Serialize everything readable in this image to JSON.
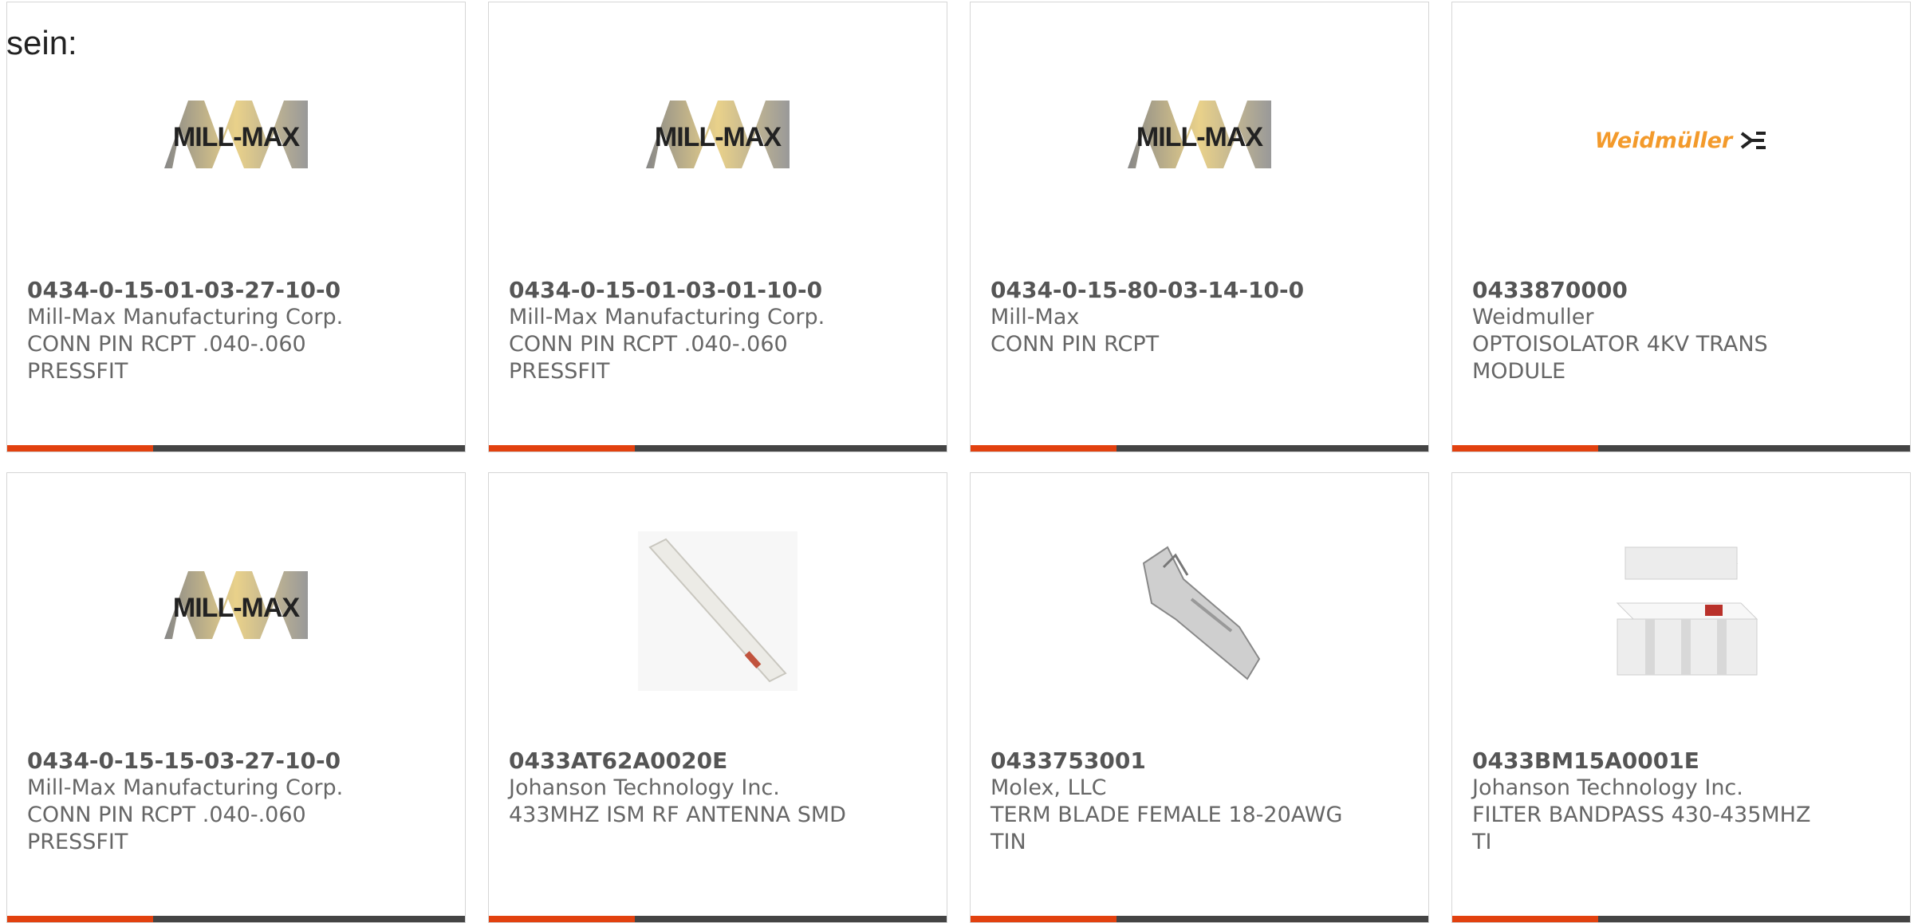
{
  "intro": "sein:",
  "cards": [
    {
      "pn": "0434-0-15-01-03-27-10-0",
      "mfr": "Mill-Max Manufacturing Corp.",
      "desc1": "CONN PIN RCPT .040-.060",
      "desc2": "PRESSFIT",
      "img": "mill-max-logo"
    },
    {
      "pn": "0434-0-15-01-03-01-10-0",
      "mfr": "Mill-Max Manufacturing Corp.",
      "desc1": "CONN PIN RCPT .040-.060",
      "desc2": "PRESSFIT",
      "img": "mill-max-logo"
    },
    {
      "pn": "0434-0-15-80-03-14-10-0",
      "mfr": "Mill-Max",
      "desc1": "CONN PIN RCPT",
      "desc2": "",
      "img": "mill-max-logo"
    },
    {
      "pn": "0433870000",
      "mfr": "Weidmuller",
      "desc1": "OPTOISOLATOR 4KV TRANS",
      "desc2": "MODULE",
      "img": "weidmuller-logo",
      "logo_text": "Weidmüller"
    },
    {
      "pn": "0434-0-15-15-03-27-10-0",
      "mfr": "Mill-Max Manufacturing Corp.",
      "desc1": "CONN PIN RCPT .040-.060",
      "desc2": "PRESSFIT",
      "img": "mill-max-logo"
    },
    {
      "pn": "0433AT62A0020E",
      "mfr": "Johanson Technology Inc.",
      "desc1": "433MHZ ISM RF ANTENNA SMD",
      "desc2": "",
      "img": "chip-antenna-photo"
    },
    {
      "pn": "0433753001",
      "mfr": "Molex, LLC",
      "desc1": "TERM BLADE FEMALE 18-20AWG",
      "desc2": "TIN",
      "img": "crimp-terminal-photo"
    },
    {
      "pn": "0433BM15A0001E",
      "mfr": "Johanson Technology Inc.",
      "desc1": "FILTER BANDPASS 430-435MHZ",
      "desc2": "TI",
      "img": "smd-filter-photo"
    }
  ],
  "colors": {
    "accent": "#e2410f",
    "bar": "#444444",
    "pn": "#555555",
    "text": "#666666"
  }
}
